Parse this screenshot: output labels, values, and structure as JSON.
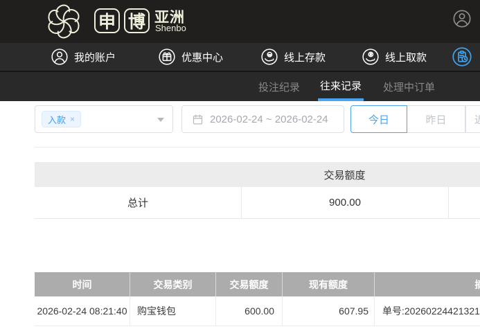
{
  "brand": {
    "char1": "申",
    "char2": "博",
    "region": "亚洲",
    "subtitle": "Shenbo"
  },
  "nav": {
    "items": [
      {
        "label": "我的账户",
        "icon": "user-icon"
      },
      {
        "label": "优惠中心",
        "icon": "gift-icon"
      },
      {
        "label": "线上存款",
        "icon": "deposit-icon"
      },
      {
        "label": "线上取款",
        "icon": "withdraw-icon"
      },
      {
        "label": "",
        "icon": "records-icon"
      }
    ]
  },
  "tabs": {
    "items": [
      {
        "label": "投注纪录",
        "active": false
      },
      {
        "label": "往来记录",
        "active": true
      },
      {
        "label": "处理中订单",
        "active": false
      }
    ]
  },
  "filters": {
    "type_tag_label": "入款",
    "tag_close_glyph": "×",
    "date_range": "2026-02-24 ~ 2026-02-24",
    "quick": [
      {
        "label": "今日",
        "active": true
      },
      {
        "label": "昨日",
        "active": false
      },
      {
        "label": "近",
        "active": false
      }
    ]
  },
  "summary": {
    "amount_header": "交易额度",
    "total_label": "总计",
    "total_value": "900.00"
  },
  "records": {
    "headers": {
      "time": "时间",
      "type": "交易类别",
      "amount": "交易额度",
      "balance": "现有额度",
      "memo": "摘要"
    },
    "rows": [
      {
        "time": "2026-02-24 08:21:40",
        "type": "购宝钱包",
        "amount": "600.00",
        "balance": "607.95",
        "memo": "单号:20260224421321"
      }
    ]
  },
  "colors": {
    "topbar_bg": "#211f1e",
    "navbar_bg": "#2b2b2b",
    "tabbar_bg": "#292929",
    "brand_cream": "#efeeda",
    "accent_blue": "#4aa3ec",
    "tag_text_blue": "#409eff",
    "tag_bg": "#ecf5ff",
    "summary_header_bg": "#ececec",
    "records_header_bg": "#acacac",
    "records_header_text": "#ffffff"
  }
}
